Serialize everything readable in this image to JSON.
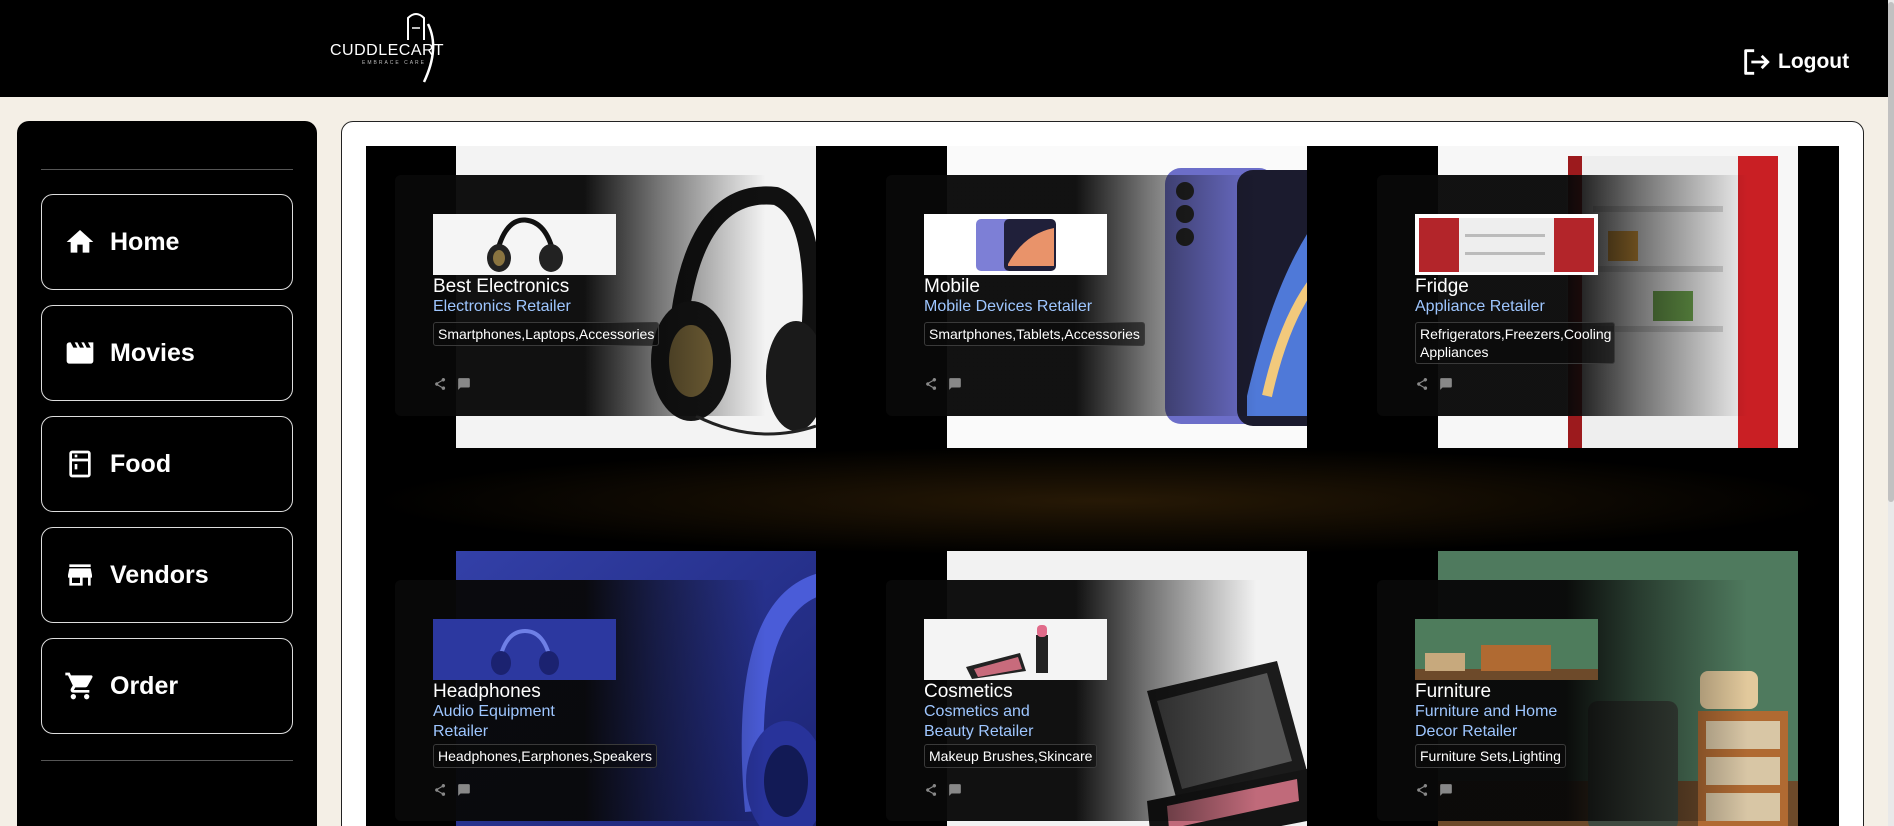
{
  "brand": {
    "name": "CUDDLECART",
    "tagline": "EMBRACE CARE"
  },
  "header": {
    "logout_label": "Logout"
  },
  "sidebar": {
    "items": [
      {
        "label": "Home",
        "icon": "home-icon"
      },
      {
        "label": "Movies",
        "icon": "clapperboard-icon"
      },
      {
        "label": "Food",
        "icon": "fridge-icon"
      },
      {
        "label": "Vendors",
        "icon": "store-icon"
      },
      {
        "label": "Order",
        "icon": "cart-icon"
      }
    ]
  },
  "vendors": [
    {
      "name": "Best Electronics",
      "type": "Electronics Retailer",
      "tags": "Smartphones,Laptops,Accessories"
    },
    {
      "name": "Mobile",
      "type": "Mobile Devices Retailer",
      "tags": "Smartphones,Tablets,Accessories"
    },
    {
      "name": "Fridge",
      "type": "Appliance Retailer",
      "tags": "Refrigerators,Freezers,Cooling Appliances"
    },
    {
      "name": "Headphones",
      "type": "Audio Equipment Retailer",
      "tags": "Headphones,Earphones,Speakers"
    },
    {
      "name": "Cosmetics",
      "type": "Cosmetics and Beauty Retailer",
      "tags": "Makeup Brushes,Skincare"
    },
    {
      "name": "Furniture",
      "type": "Furniture and Home Decor Retailer",
      "tags": "Furniture Sets,Lighting"
    }
  ]
}
